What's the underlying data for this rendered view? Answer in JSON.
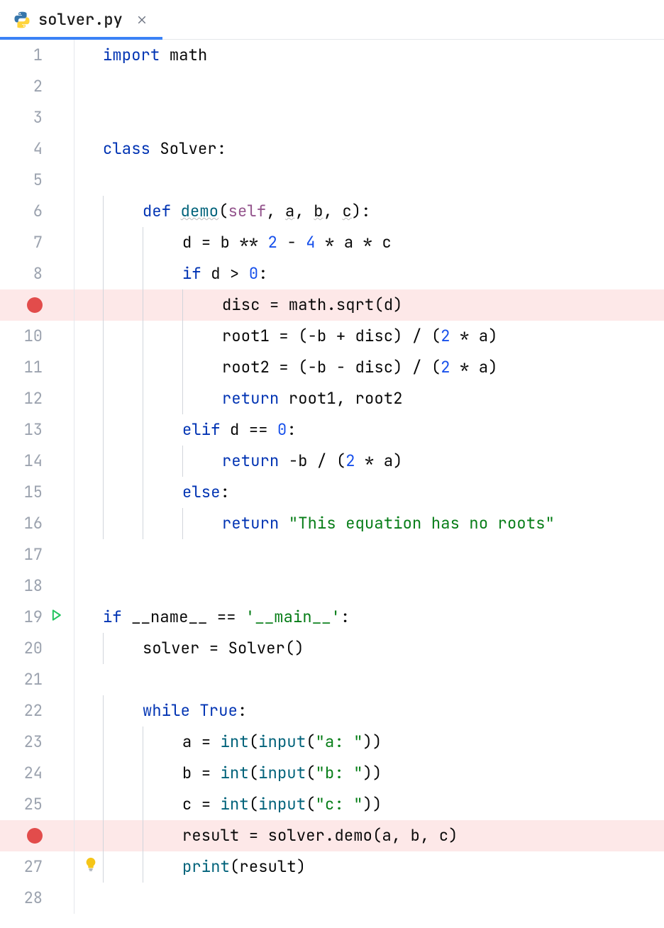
{
  "tab": {
    "filename": "solver.py",
    "file_icon": "python-icon"
  },
  "lines": [
    {
      "num": "1",
      "indent": 0,
      "guides": [],
      "marker": null,
      "tokens": [
        [
          "k",
          "import "
        ],
        [
          "id",
          "math"
        ]
      ]
    },
    {
      "num": "2",
      "indent": 0,
      "guides": [],
      "marker": null,
      "tokens": []
    },
    {
      "num": "3",
      "indent": 0,
      "guides": [],
      "marker": null,
      "tokens": []
    },
    {
      "num": "4",
      "indent": 0,
      "guides": [],
      "marker": null,
      "tokens": [
        [
          "k",
          "class "
        ],
        [
          "id",
          "Solver"
        ],
        [
          "p",
          ":"
        ]
      ]
    },
    {
      "num": "5",
      "indent": 0,
      "guides": [],
      "marker": null,
      "tokens": []
    },
    {
      "num": "6",
      "indent": 1,
      "guides": [
        1
      ],
      "marker": null,
      "tokens": [
        [
          "k",
          "def "
        ],
        [
          "fn",
          "demo",
          true
        ],
        [
          "p",
          "("
        ],
        [
          "self",
          "self"
        ],
        [
          "p",
          ", "
        ],
        [
          "id",
          "a",
          true
        ],
        [
          "p",
          ", "
        ],
        [
          "id",
          "b",
          true
        ],
        [
          "p",
          ", "
        ],
        [
          "id",
          "c",
          true
        ],
        [
          "p",
          ")"
        ],
        [
          "p",
          ":"
        ]
      ]
    },
    {
      "num": "7",
      "indent": 2,
      "guides": [
        1,
        2
      ],
      "marker": null,
      "tokens": [
        [
          "id",
          "d "
        ],
        [
          "op",
          "= "
        ],
        [
          "id",
          "b "
        ],
        [
          "op",
          "** "
        ],
        [
          "n",
          "2"
        ],
        [
          "op",
          " - "
        ],
        [
          "n",
          "4"
        ],
        [
          "op",
          " * "
        ],
        [
          "id",
          "a "
        ],
        [
          "op",
          "* "
        ],
        [
          "id",
          "c"
        ]
      ]
    },
    {
      "num": "8",
      "indent": 2,
      "guides": [
        1,
        2
      ],
      "marker": null,
      "tokens": [
        [
          "k",
          "if "
        ],
        [
          "id",
          "d "
        ],
        [
          "op",
          "> "
        ],
        [
          "n",
          "0"
        ],
        [
          "p",
          ":"
        ]
      ]
    },
    {
      "num": "",
      "indent": 3,
      "guides": [
        1,
        2,
        3
      ],
      "marker": "breakpoint",
      "tokens": [
        [
          "id",
          "disc "
        ],
        [
          "op",
          "= "
        ],
        [
          "id",
          "math"
        ],
        [
          "p",
          "."
        ],
        [
          "id",
          "sqrt"
        ],
        [
          "p",
          "("
        ],
        [
          "id",
          "d"
        ],
        [
          "p",
          ")"
        ]
      ]
    },
    {
      "num": "10",
      "indent": 3,
      "guides": [
        1,
        2,
        3
      ],
      "marker": null,
      "tokens": [
        [
          "id",
          "root1 "
        ],
        [
          "op",
          "= "
        ],
        [
          "p",
          "("
        ],
        [
          "op",
          "-"
        ],
        [
          "id",
          "b "
        ],
        [
          "op",
          "+ "
        ],
        [
          "id",
          "disc"
        ],
        [
          "p",
          ") "
        ],
        [
          "op",
          "/ "
        ],
        [
          "p",
          "("
        ],
        [
          "n",
          "2"
        ],
        [
          "op",
          " * "
        ],
        [
          "id",
          "a"
        ],
        [
          "p",
          ")"
        ]
      ]
    },
    {
      "num": "11",
      "indent": 3,
      "guides": [
        1,
        2,
        3
      ],
      "marker": null,
      "tokens": [
        [
          "id",
          "root2 "
        ],
        [
          "op",
          "= "
        ],
        [
          "p",
          "("
        ],
        [
          "op",
          "-"
        ],
        [
          "id",
          "b "
        ],
        [
          "op",
          "- "
        ],
        [
          "id",
          "disc"
        ],
        [
          "p",
          ") "
        ],
        [
          "op",
          "/ "
        ],
        [
          "p",
          "("
        ],
        [
          "n",
          "2"
        ],
        [
          "op",
          " * "
        ],
        [
          "id",
          "a"
        ],
        [
          "p",
          ")"
        ]
      ]
    },
    {
      "num": "12",
      "indent": 3,
      "guides": [
        1,
        2,
        3
      ],
      "marker": null,
      "tokens": [
        [
          "k",
          "return "
        ],
        [
          "id",
          "root1"
        ],
        [
          "p",
          ", "
        ],
        [
          "id",
          "root2"
        ]
      ]
    },
    {
      "num": "13",
      "indent": 2,
      "guides": [
        1,
        2
      ],
      "marker": null,
      "tokens": [
        [
          "k",
          "elif "
        ],
        [
          "id",
          "d "
        ],
        [
          "op",
          "== "
        ],
        [
          "n",
          "0"
        ],
        [
          "p",
          ":"
        ]
      ]
    },
    {
      "num": "14",
      "indent": 3,
      "guides": [
        1,
        2,
        3
      ],
      "marker": null,
      "tokens": [
        [
          "k",
          "return "
        ],
        [
          "op",
          "-"
        ],
        [
          "id",
          "b "
        ],
        [
          "op",
          "/ "
        ],
        [
          "p",
          "("
        ],
        [
          "n",
          "2"
        ],
        [
          "op",
          " * "
        ],
        [
          "id",
          "a"
        ],
        [
          "p",
          ")"
        ]
      ]
    },
    {
      "num": "15",
      "indent": 2,
      "guides": [
        1,
        2
      ],
      "marker": null,
      "tokens": [
        [
          "k",
          "else"
        ],
        [
          "p",
          ":"
        ]
      ]
    },
    {
      "num": "16",
      "indent": 3,
      "guides": [
        1,
        2,
        3
      ],
      "marker": null,
      "tokens": [
        [
          "k",
          "return "
        ],
        [
          "s",
          "\"This equation has no roots\""
        ]
      ]
    },
    {
      "num": "17",
      "indent": 0,
      "guides": [],
      "marker": null,
      "tokens": []
    },
    {
      "num": "18",
      "indent": 0,
      "guides": [],
      "marker": null,
      "tokens": []
    },
    {
      "num": "19",
      "indent": 0,
      "guides": [],
      "marker": "run",
      "tokens": [
        [
          "k",
          "if "
        ],
        [
          "id",
          "__name__ "
        ],
        [
          "op",
          "== "
        ],
        [
          "s",
          "'__main__'"
        ],
        [
          "p",
          ":"
        ]
      ]
    },
    {
      "num": "20",
      "indent": 1,
      "guides": [
        1
      ],
      "marker": null,
      "tokens": [
        [
          "id",
          "solver "
        ],
        [
          "op",
          "= "
        ],
        [
          "id",
          "Solver"
        ],
        [
          "p",
          "()"
        ]
      ]
    },
    {
      "num": "21",
      "indent": 0,
      "guides": [
        1
      ],
      "marker": null,
      "tokens": []
    },
    {
      "num": "22",
      "indent": 1,
      "guides": [
        1
      ],
      "marker": null,
      "tokens": [
        [
          "k",
          "while "
        ],
        [
          "k",
          "True"
        ],
        [
          "p",
          ":"
        ]
      ]
    },
    {
      "num": "23",
      "indent": 2,
      "guides": [
        1,
        2
      ],
      "marker": null,
      "tokens": [
        [
          "id",
          "a "
        ],
        [
          "op",
          "= "
        ],
        [
          "fn",
          "int"
        ],
        [
          "p",
          "("
        ],
        [
          "fn",
          "input"
        ],
        [
          "p",
          "("
        ],
        [
          "s",
          "\"a: \""
        ],
        [
          "p",
          "))"
        ]
      ]
    },
    {
      "num": "24",
      "indent": 2,
      "guides": [
        1,
        2
      ],
      "marker": null,
      "tokens": [
        [
          "id",
          "b "
        ],
        [
          "op",
          "= "
        ],
        [
          "fn",
          "int"
        ],
        [
          "p",
          "("
        ],
        [
          "fn",
          "input"
        ],
        [
          "p",
          "("
        ],
        [
          "s",
          "\"b: \""
        ],
        [
          "p",
          "))"
        ]
      ]
    },
    {
      "num": "25",
      "indent": 2,
      "guides": [
        1,
        2
      ],
      "marker": null,
      "tokens": [
        [
          "id",
          "c "
        ],
        [
          "op",
          "= "
        ],
        [
          "fn",
          "int"
        ],
        [
          "p",
          "("
        ],
        [
          "fn",
          "input"
        ],
        [
          "p",
          "("
        ],
        [
          "s",
          "\"c: \""
        ],
        [
          "p",
          "))"
        ]
      ]
    },
    {
      "num": "",
      "indent": 2,
      "guides": [
        1,
        2
      ],
      "marker": "breakpoint",
      "tokens": [
        [
          "id",
          "result "
        ],
        [
          "op",
          "= "
        ],
        [
          "id",
          "solver"
        ],
        [
          "p",
          "."
        ],
        [
          "id",
          "demo"
        ],
        [
          "p",
          "("
        ],
        [
          "id",
          "a"
        ],
        [
          "p",
          ", "
        ],
        [
          "id",
          "b"
        ],
        [
          "p",
          ", "
        ],
        [
          "id",
          "c"
        ],
        [
          "p",
          ")"
        ]
      ]
    },
    {
      "num": "27",
      "indent": 2,
      "guides": [
        1,
        2
      ],
      "marker": "bulb",
      "tokens": [
        [
          "fn",
          "print"
        ],
        [
          "p",
          "("
        ],
        [
          "id",
          "result"
        ],
        [
          "p",
          ")"
        ]
      ]
    },
    {
      "num": "28",
      "indent": 0,
      "guides": [],
      "marker": null,
      "tokens": []
    }
  ]
}
